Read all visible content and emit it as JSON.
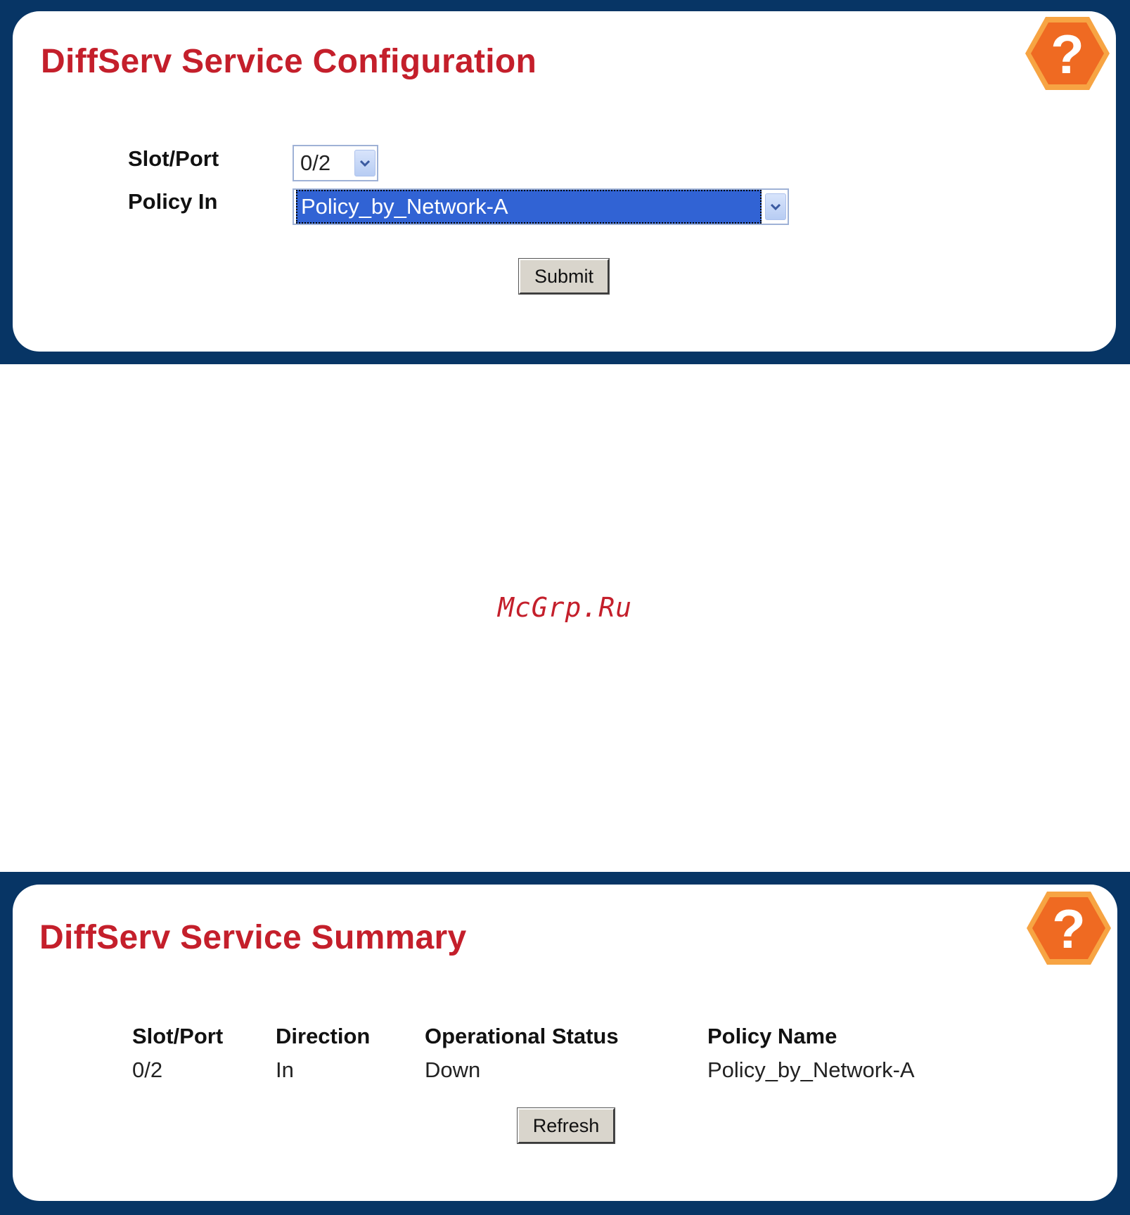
{
  "config": {
    "title": "DiffServ Service Configuration",
    "help_icon": "help-question-icon",
    "slot_port_label": "Slot/Port",
    "slot_port_value": "0/2",
    "policy_in_label": "Policy In",
    "policy_in_value": "Policy_by_Network-A",
    "submit_label": "Submit"
  },
  "watermark": "McGrp.Ru",
  "summary": {
    "title": "DiffServ Service Summary",
    "help_icon": "help-question-icon",
    "columns": [
      "Slot/Port",
      "Direction",
      "Operational Status",
      "Policy Name"
    ],
    "rows": [
      [
        "0/2",
        "In",
        "Down",
        "Policy_by_Network-A"
      ]
    ],
    "refresh_label": "Refresh"
  },
  "colors": {
    "frame": "#073565",
    "title": "#c41f2b",
    "help_orange": "#ef6a22",
    "help_ring": "#f7a443",
    "selection": "#3163d4"
  }
}
